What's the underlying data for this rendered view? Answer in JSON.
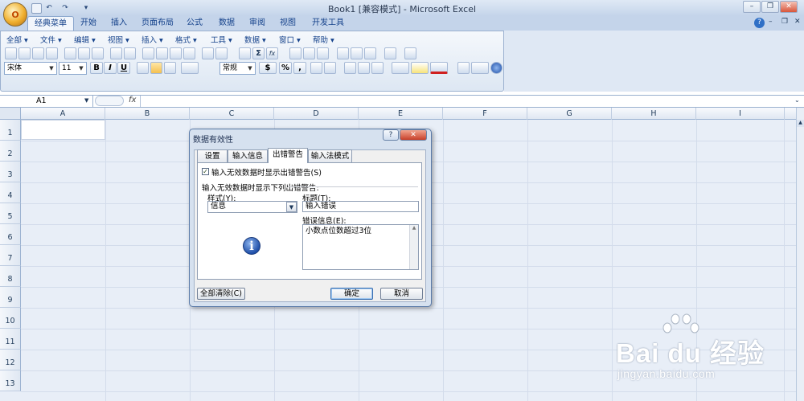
{
  "window": {
    "title": "Book1  [兼容模式] - Microsoft Excel",
    "office_button_label": "O"
  },
  "ribbon_tabs": [
    "经典菜单",
    "开始",
    "插入",
    "页面布局",
    "公式",
    "数据",
    "审阅",
    "视图",
    "开发工具"
  ],
  "menu": [
    "全部 ▾",
    "文件 ▾",
    "编辑 ▾",
    "视图 ▾",
    "插入 ▾",
    "格式 ▾",
    "工具 ▾",
    "数据 ▾",
    "窗口 ▾",
    "帮助 ▾"
  ],
  "toolbar": {
    "font": "宋体",
    "font_size": "11",
    "bold": "B",
    "italic": "I",
    "underline": "U",
    "number_format": "常规",
    "percent": "%",
    "comma": ",",
    "sum": "Σ",
    "fx_btn": "fx"
  },
  "formula_bar": {
    "name_box": "A1",
    "fx": "fx",
    "value": ""
  },
  "columns": [
    "A",
    "B",
    "C",
    "D",
    "E",
    "F",
    "G",
    "H",
    "I"
  ],
  "rows": [
    "1",
    "2",
    "3",
    "4",
    "5",
    "6",
    "7",
    "8",
    "9",
    "10",
    "11",
    "12",
    "13"
  ],
  "dialog": {
    "title": "数据有效性",
    "help": "?",
    "close": "✕",
    "tabs": [
      "设置",
      "输入信息",
      "出错警告",
      "输入法模式"
    ],
    "checkbox_label": "输入无效数据时显示出错警告(S)",
    "section_label": "输入无效数据时显示下列出错警告:",
    "style_label": "样式(Y):",
    "style_value": "信息",
    "title_label": "标题(T):",
    "title_value": "输入错误",
    "message_label": "错误信息(E):",
    "message_value": "小数点位数超过3位",
    "clear_all": "全部清除(C)",
    "ok": "确定",
    "cancel": "取消"
  },
  "watermark": {
    "brand": "Bai du 经验",
    "url": "jingyan.baidu.com"
  }
}
